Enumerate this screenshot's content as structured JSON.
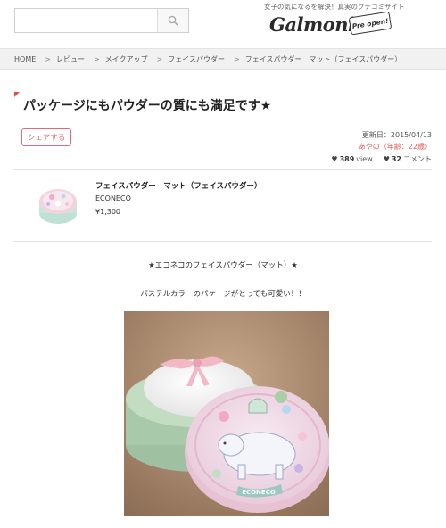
{
  "header": {
    "search_placeholder": "",
    "tagline": "女子の気になるを解決！真実のクチコミサイト",
    "logo_text": "Galmoni",
    "logo_badge": "Pre open!"
  },
  "breadcrumb": [
    {
      "label": "HOME"
    },
    {
      "label": "レビュー"
    },
    {
      "label": "メイクアップ"
    },
    {
      "label": "フェイスパウダー"
    },
    {
      "label": "フェイスパウダー　マット（フェイスパウダー）"
    }
  ],
  "article": {
    "title": "パッケージにもパウダーの質にも満足です★",
    "share_label": "シェアする",
    "updated": "更新日：2015/04/13",
    "author": "あやの",
    "age": "（年齢：22歳）",
    "views_count": "389",
    "views_label": "view",
    "comments_count": "32",
    "comments_label": "コメント"
  },
  "product": {
    "name": "フェイスパウダー　マット（フェイスパウダー）",
    "brand": "ECONECO",
    "price": "¥1,300"
  },
  "body": {
    "line1": "★エコネコのフェイスパウダー（マット）★",
    "line2": "パステルカラーのパケージがとっても可愛い！！"
  },
  "photo": {
    "label_text": "ECONECO"
  },
  "colors": {
    "accent": "#e06a78",
    "author": "#e05a5a",
    "title_mark": "#e24b4b"
  }
}
